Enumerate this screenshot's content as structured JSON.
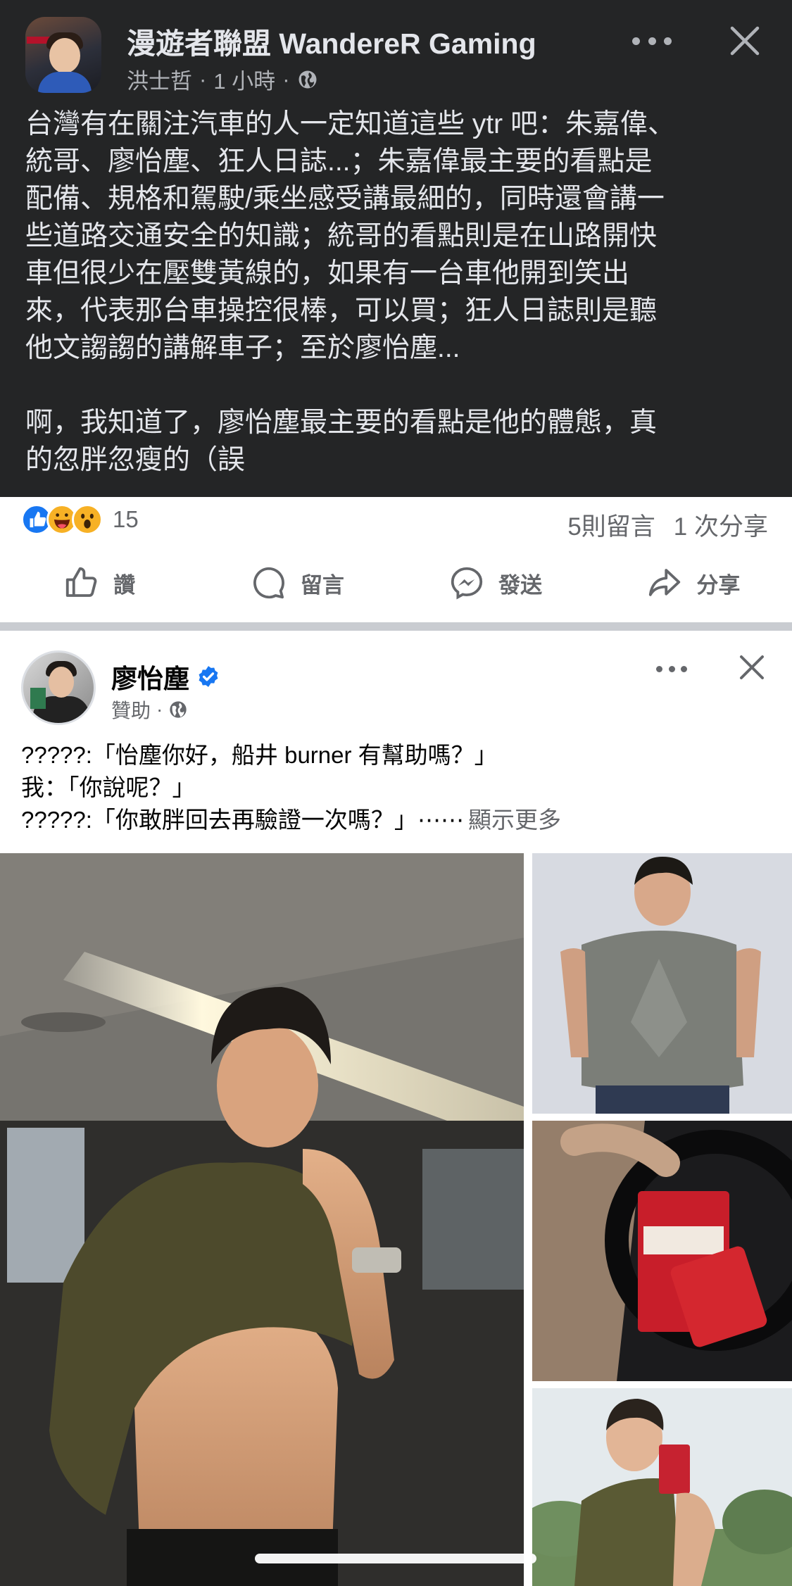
{
  "post": {
    "page_name": "漫遊者聯盟 WandereR Gaming",
    "author": "洪士哲",
    "time": "1 小時",
    "dot": "·",
    "avatar_icon": "user-avatar",
    "text_lines": [
      "台灣有在關注汽車的人一定知道這些 ytr 吧：朱嘉偉、",
      "統哥、廖怡塵、狂人日誌...；朱嘉偉最主要的看點是",
      "配備、規格和駕駛/乘坐感受講最細的，同時還會講一",
      "些道路交通安全的知識；統哥的看點則是在山路開快",
      "車但很少在壓雙黃線的，如果有一台車他開到笑出",
      "來，代表那台車操控很棒，可以買；狂人日誌則是聽",
      "他文謅謅的講解車子；至於廖怡塵...",
      "",
      "啊，我知道了，廖怡塵最主要的看點是他的體態，真",
      "的忽胖忽瘦的（誤"
    ],
    "reaction_count": "15",
    "comments": "5則留言",
    "shares": "1 次分享"
  },
  "actions": {
    "like": "讚",
    "comment": "留言",
    "send": "發送",
    "share": "分享"
  },
  "ad": {
    "name": "廖怡塵",
    "sponsored": "贊助",
    "dot": "·",
    "lines": [
      "?????:「怡塵你好，船井 burner 有幫助嗎？」",
      "我：「你說呢？」",
      "?????:「你敢胖回去再驗證一次嗎？」⋯⋯"
    ],
    "see_more": "顯示更多"
  },
  "colors": {
    "dark_bg": "#242526",
    "facebook_blue": "#1877f2",
    "secondary_text": "#65676b"
  }
}
